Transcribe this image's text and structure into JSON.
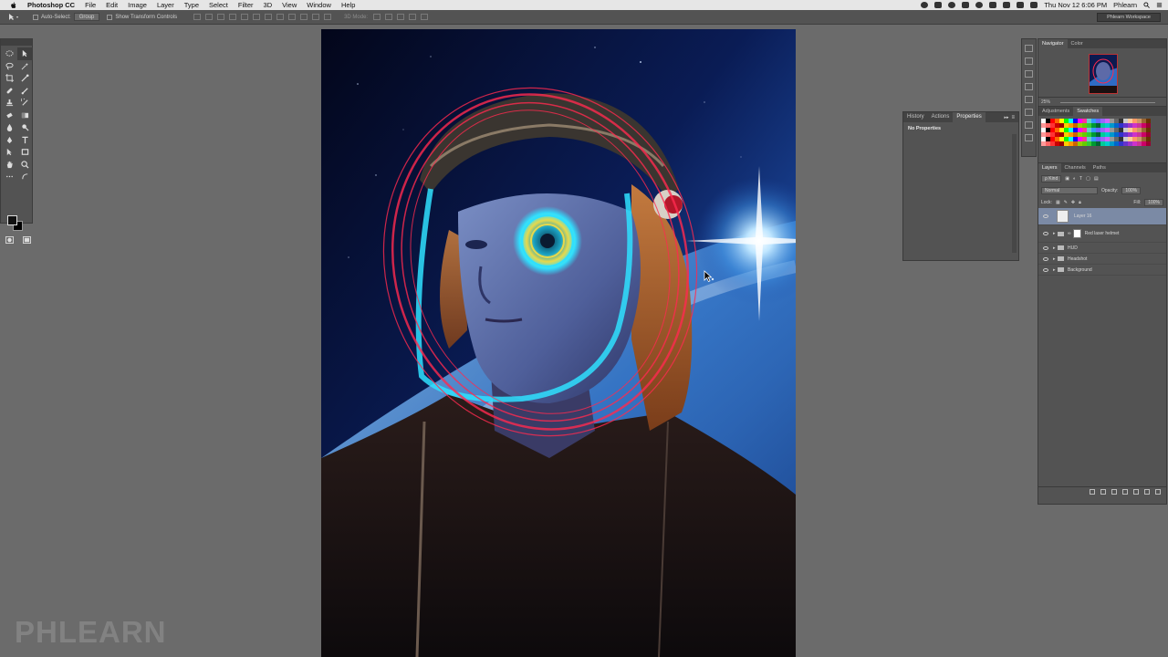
{
  "menubar": {
    "app_name": "Photoshop CC",
    "menus": [
      "File",
      "Edit",
      "Image",
      "Layer",
      "Type",
      "Select",
      "Filter",
      "3D",
      "View",
      "Window",
      "Help"
    ],
    "clock": "Thu Nov 12  6:06 PM",
    "user": "Phlearn"
  },
  "options": {
    "auto_select_label": "Auto-Select:",
    "auto_select_value": "Group",
    "transform_label": "Show Transform Controls",
    "mode_3d_label": "3D Mode:",
    "workspace": "Phlearn Workspace"
  },
  "properties_panel": {
    "tabs": [
      "History",
      "Actions",
      "Properties"
    ],
    "active_tab": "Properties",
    "title": "No Properties"
  },
  "navigator": {
    "tabs": [
      "Navigator",
      "Color"
    ],
    "zoom": "25%"
  },
  "swatches_panel": {
    "tabs": [
      "Adjustments",
      "Swatches"
    ],
    "colors": [
      "#ffffff",
      "#000000",
      "#ff0000",
      "#ff6600",
      "#ffff00",
      "#00ff00",
      "#00ffff",
      "#0000ff",
      "#ff00ff",
      "#ff3399",
      "#66cccc",
      "#3399ff",
      "#6666ff",
      "#9966ff",
      "#cc66ff",
      "#999999",
      "#666666",
      "#333333",
      "#cccccc",
      "#ffcc99",
      "#ff9966",
      "#cc9966",
      "#996633",
      "#663300",
      "#ff9999",
      "#ff6666",
      "#ff3333",
      "#cc0000",
      "#990000",
      "#ffcc00",
      "#ff9900",
      "#cc6600",
      "#99cc00",
      "#66cc00",
      "#33cc33",
      "#009933",
      "#006633",
      "#00cc99",
      "#00cccc",
      "#0099cc",
      "#0066cc",
      "#3333cc",
      "#6633cc",
      "#9933cc",
      "#cc33cc",
      "#cc3399",
      "#cc0066",
      "#990033"
    ],
    "rows": 6
  },
  "layers": {
    "tabs": [
      "Layers",
      "Channels",
      "Paths"
    ],
    "filter_label": "ρ Kind",
    "blend_mode": "Normal",
    "opacity_label": "Opacity:",
    "opacity": "100%",
    "lock_label": "Lock:",
    "fill_label": "Fill:",
    "fill": "100%",
    "items": [
      {
        "name": "Layer 16",
        "type": "layer",
        "selected": true
      },
      {
        "name": "Red laser helmet",
        "type": "group-mask",
        "selected": false
      },
      {
        "name": "HUD",
        "type": "group",
        "selected": false
      },
      {
        "name": "Headshot",
        "type": "group",
        "selected": false
      },
      {
        "name": "Background",
        "type": "group",
        "selected": false
      }
    ]
  },
  "watermark": "PHLEARN",
  "colors": {
    "panel_bg": "#535353",
    "workspace_bg": "#6b6b6b",
    "selection": "#7b8aa5"
  }
}
